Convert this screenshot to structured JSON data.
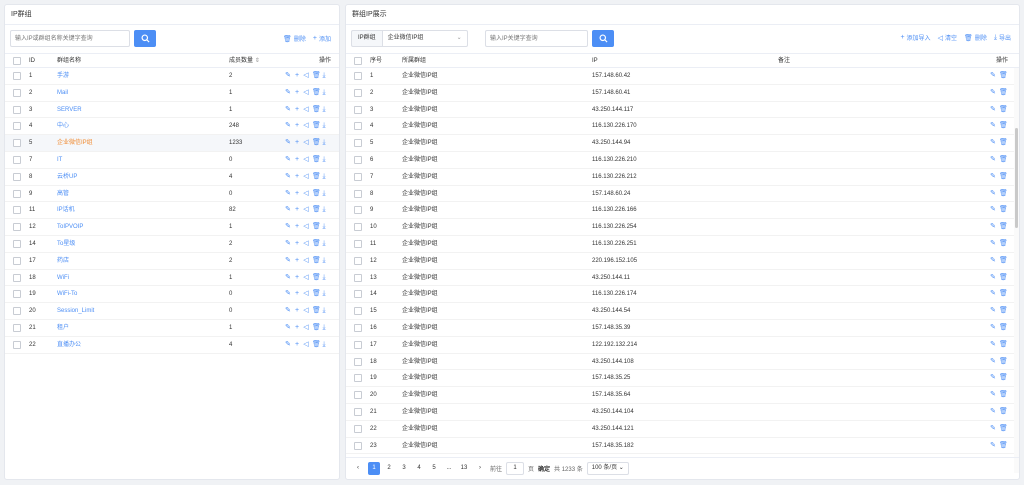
{
  "left": {
    "title": "IP群组",
    "search_placeholder": "输入IP或群组名称关键字查询",
    "delete_label": "删除",
    "add_label": "添加",
    "columns": {
      "id": "ID",
      "name": "群组名称",
      "count": "成员数量",
      "ops": "操作"
    },
    "rows": [
      {
        "id": "1",
        "name": "手游",
        "count": "2"
      },
      {
        "id": "2",
        "name": "Mail",
        "count": "1"
      },
      {
        "id": "3",
        "name": "SERVER",
        "count": "1"
      },
      {
        "id": "4",
        "name": "中心",
        "count": "248"
      },
      {
        "id": "5",
        "name": "企业微信IP组",
        "count": "1233"
      },
      {
        "id": "7",
        "name": "IT",
        "count": "0"
      },
      {
        "id": "8",
        "name": "云桥UP",
        "count": "4"
      },
      {
        "id": "9",
        "name": "高管",
        "count": "0"
      },
      {
        "id": "11",
        "name": "IP话机",
        "count": "82"
      },
      {
        "id": "12",
        "name": "ToIPVOIP",
        "count": "1"
      },
      {
        "id": "14",
        "name": "To星级",
        "count": "2"
      },
      {
        "id": "17",
        "name": "药店",
        "count": "2"
      },
      {
        "id": "18",
        "name": "WiFi",
        "count": "1"
      },
      {
        "id": "19",
        "name": "WiFi-To",
        "count": "0"
      },
      {
        "id": "20",
        "name": "Session_Limit",
        "count": "0"
      },
      {
        "id": "21",
        "name": "租户",
        "count": "1"
      },
      {
        "id": "22",
        "name": "直播办公",
        "count": "4"
      }
    ]
  },
  "right": {
    "title": "群组IP展示",
    "select_label": "IP群组",
    "select_value": "企业微信IP组",
    "search_placeholder": "输入IP关键字查询",
    "add_import_label": "添加导入",
    "clear_label": "清空",
    "delete_label": "删除",
    "export_label": "导出",
    "columns": {
      "seq": "序号",
      "group": "所属群组",
      "ip": "IP",
      "note": "备注",
      "ops": "操作"
    },
    "rows": [
      {
        "seq": "1",
        "group": "企业微信IP组",
        "ip": "157.148.60.42"
      },
      {
        "seq": "2",
        "group": "企业微信IP组",
        "ip": "157.148.60.41"
      },
      {
        "seq": "3",
        "group": "企业微信IP组",
        "ip": "43.250.144.117"
      },
      {
        "seq": "4",
        "group": "企业微信IP组",
        "ip": "116.130.226.170"
      },
      {
        "seq": "5",
        "group": "企业微信IP组",
        "ip": "43.250.144.94"
      },
      {
        "seq": "6",
        "group": "企业微信IP组",
        "ip": "116.130.226.210"
      },
      {
        "seq": "7",
        "group": "企业微信IP组",
        "ip": "116.130.226.212"
      },
      {
        "seq": "8",
        "group": "企业微信IP组",
        "ip": "157.148.60.24"
      },
      {
        "seq": "9",
        "group": "企业微信IP组",
        "ip": "116.130.226.166"
      },
      {
        "seq": "10",
        "group": "企业微信IP组",
        "ip": "116.130.226.254"
      },
      {
        "seq": "11",
        "group": "企业微信IP组",
        "ip": "116.130.226.251"
      },
      {
        "seq": "12",
        "group": "企业微信IP组",
        "ip": "220.196.152.105"
      },
      {
        "seq": "13",
        "group": "企业微信IP组",
        "ip": "43.250.144.11"
      },
      {
        "seq": "14",
        "group": "企业微信IP组",
        "ip": "116.130.226.174"
      },
      {
        "seq": "15",
        "group": "企业微信IP组",
        "ip": "43.250.144.54"
      },
      {
        "seq": "16",
        "group": "企业微信IP组",
        "ip": "157.148.35.39"
      },
      {
        "seq": "17",
        "group": "企业微信IP组",
        "ip": "122.192.132.214"
      },
      {
        "seq": "18",
        "group": "企业微信IP组",
        "ip": "43.250.144.108"
      },
      {
        "seq": "19",
        "group": "企业微信IP组",
        "ip": "157.148.35.25"
      },
      {
        "seq": "20",
        "group": "企业微信IP组",
        "ip": "157.148.35.64"
      },
      {
        "seq": "21",
        "group": "企业微信IP组",
        "ip": "43.250.144.104"
      },
      {
        "seq": "22",
        "group": "企业微信IP组",
        "ip": "43.250.144.121"
      },
      {
        "seq": "23",
        "group": "企业微信IP组",
        "ip": "157.148.35.182"
      }
    ],
    "pagination": {
      "pages": [
        "1",
        "2",
        "3",
        "4",
        "5",
        "...",
        "13"
      ],
      "goto_label": "前往",
      "goto_value": "1",
      "page_unit": "页",
      "confirm_label": "确定",
      "total_label": "共 1233 条",
      "page_size": "100 条/页"
    }
  },
  "colors": {
    "accent": "#4c8ef5",
    "highlight_text": "#f08c34"
  }
}
